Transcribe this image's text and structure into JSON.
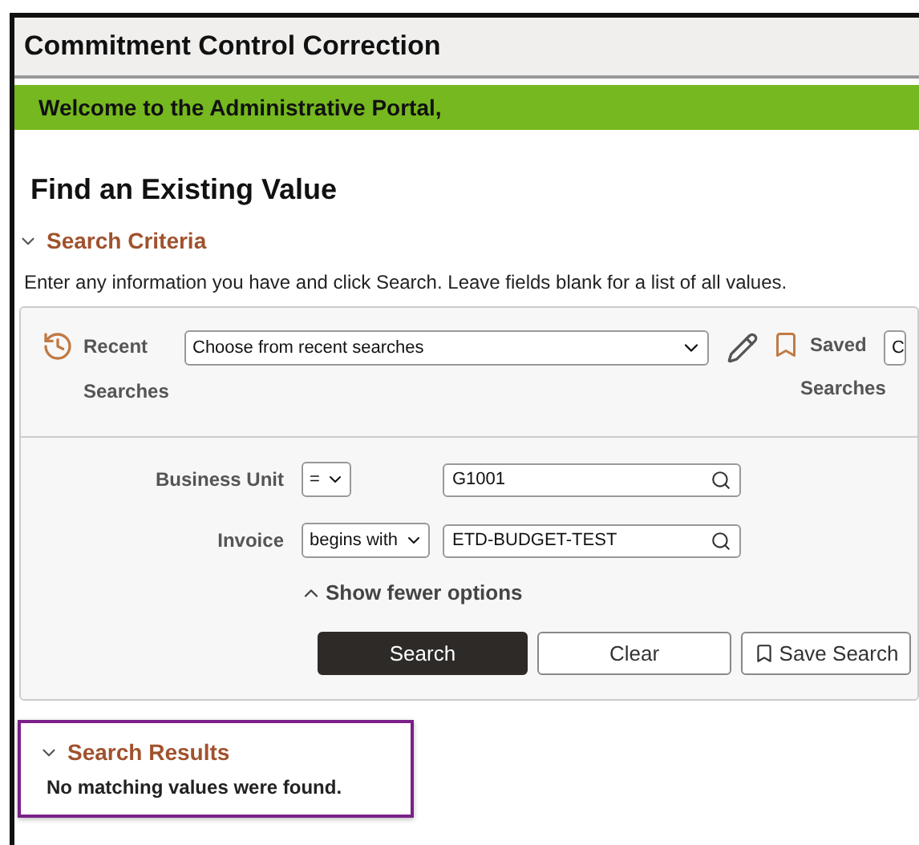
{
  "window": {
    "title": "Commitment Control Correction"
  },
  "banner": {
    "text": "Welcome to the Administrative Portal,"
  },
  "page_title": "Find an Existing Value",
  "search_criteria": {
    "title": "Search Criteria",
    "expanded": true,
    "instructions": "Enter any information you have and click Search. Leave fields blank for a list of all values.",
    "recent": {
      "label_line_1": "Recent",
      "label_line_2": "Searches",
      "placeholder": "Choose from recent searches"
    },
    "saved": {
      "label_line_1": "Saved",
      "label_line_2": "Searches",
      "value": "C"
    },
    "fields": [
      {
        "label": "Business Unit",
        "operator": "=",
        "value": "G1001"
      },
      {
        "label": "Invoice",
        "operator": "begins with",
        "value": "ETD-BUDGET-TEST"
      }
    ],
    "options_toggle": {
      "label": "Show fewer options",
      "expanded": true
    },
    "buttons": [
      {
        "kind": "primary",
        "label": "Search"
      },
      {
        "kind": "plain",
        "label": "Clear"
      },
      {
        "kind": "save",
        "label": "Save Search"
      }
    ]
  },
  "search_results": {
    "title": "Search Results",
    "expanded": true,
    "message": "No matching values were found."
  }
}
